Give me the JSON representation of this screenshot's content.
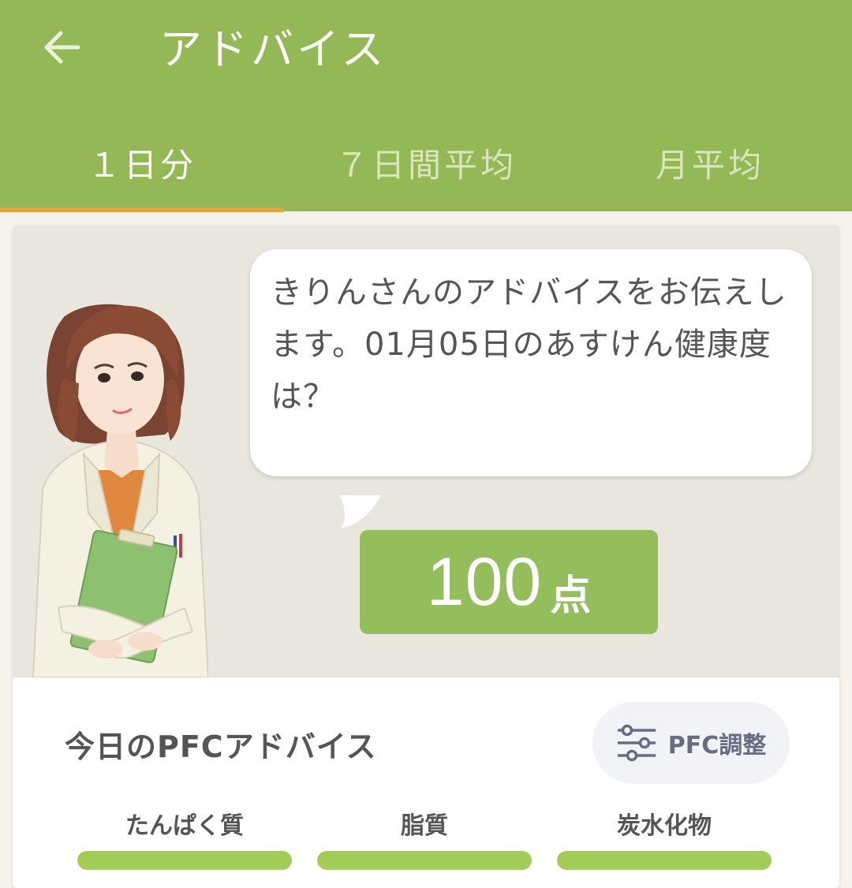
{
  "header": {
    "title": "アドバイス"
  },
  "tabs": [
    {
      "label": "１日分",
      "active": true
    },
    {
      "label": "７日間平均",
      "active": false
    },
    {
      "label": "月平均",
      "active": false
    }
  ],
  "advice": {
    "message": "きりんさんのアドバイスをお伝えします。01月05日のあすけん健康度は？",
    "score_value": "100",
    "score_unit": "点"
  },
  "pfc": {
    "title": "今日のPFCアドバイス",
    "adjust_button": "PFC調整",
    "nutrients": [
      {
        "label": "たんぱく質",
        "progress": 1.0
      },
      {
        "label": "脂質",
        "progress": 1.0
      },
      {
        "label": "炭水化物",
        "progress": 1.0
      }
    ]
  },
  "colors": {
    "app_bar": "#94b855",
    "tab_indicator": "#e8a23a",
    "score_bg": "#94bd5b",
    "bar_fill": "#a2cc55"
  }
}
